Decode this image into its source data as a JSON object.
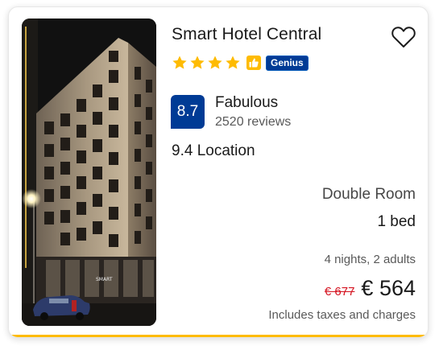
{
  "hotel": {
    "name": "Smart Hotel Central",
    "star_count": 4,
    "genius_label": "Genius",
    "photo_alt": "Smart Hotel building at night",
    "photo_sign_text": "SMART"
  },
  "rating": {
    "score": "8.7",
    "word": "Fabulous",
    "reviews": "2520 reviews"
  },
  "location_score": "9.4 Location",
  "room": {
    "type": "Double Room",
    "beds": "1 bed"
  },
  "stay": {
    "summary": "4 nights, 2 adults"
  },
  "price": {
    "original": "€ 677",
    "current": "€ 564",
    "note": "Includes taxes and charges"
  },
  "colors": {
    "brand_blue": "#003b95",
    "star_yellow": "#febb02",
    "strike_red": "#d4111e",
    "accent_bar": "#febb02"
  },
  "icons": {
    "save": "heart-icon",
    "star": "star-icon",
    "preferred": "thumbs-up-icon"
  }
}
